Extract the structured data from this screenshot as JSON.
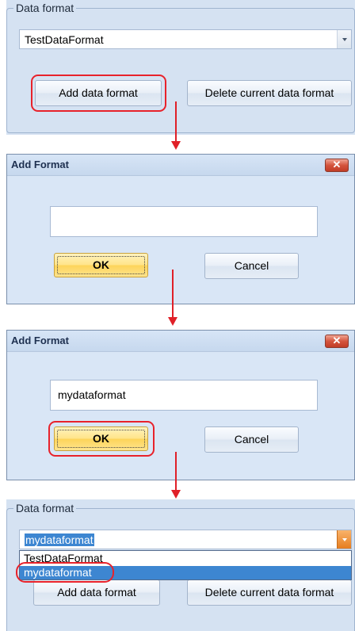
{
  "panel1": {
    "group_label": "Data format",
    "combo_value": "TestDataFormat",
    "add_button": "Add data format",
    "delete_button": "Delete current data format"
  },
  "dialog1": {
    "title": "Add Format",
    "close_glyph": "✕",
    "input_value": "",
    "ok_label": "OK",
    "cancel_label": "Cancel"
  },
  "dialog2": {
    "title": "Add Format",
    "close_glyph": "✕",
    "input_value": "mydataformat",
    "ok_label": "OK",
    "cancel_label": "Cancel"
  },
  "panel2": {
    "group_label": "Data format",
    "combo_value": "mydataformat",
    "dropdown_items": [
      "TestDataFormat",
      "mydataformat"
    ],
    "add_button": "Add data format",
    "delete_button": "Delete current data format"
  },
  "colors": {
    "annotation_red": "#e02028",
    "panel_bg": "#d5e2f2",
    "ok_yellow": "#fdd45a",
    "selection_blue": "#3d86d1"
  },
  "icons": [
    "chevron-down-icon",
    "close-icon",
    "arrow-down-icon"
  ]
}
